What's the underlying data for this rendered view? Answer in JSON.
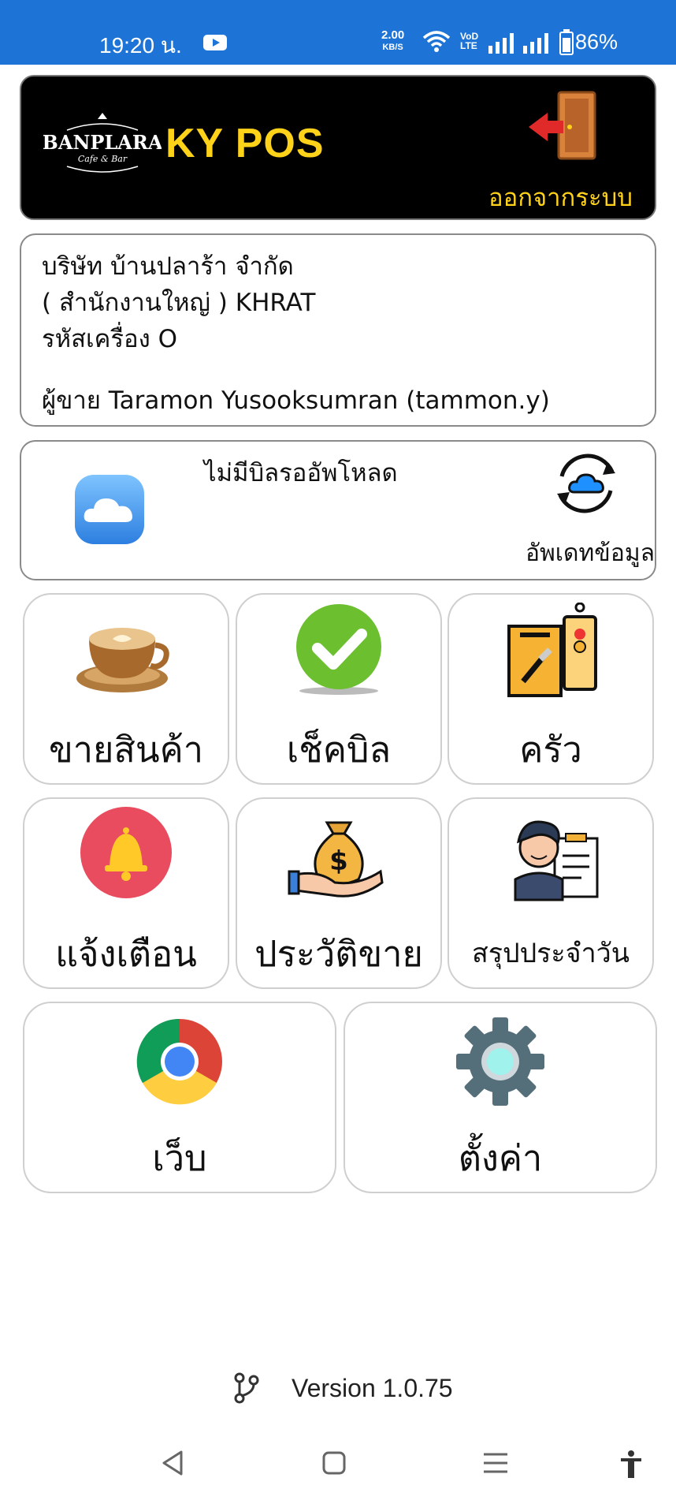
{
  "status_bar": {
    "time": "19:20 น.",
    "speed_value": "2.00",
    "speed_unit": "KB/S",
    "volte_top": "VoD",
    "volte_bottom": "LTE",
    "battery": "86%"
  },
  "header": {
    "logo_text": "BANPLARA",
    "logo_sub": "Cafe & Bar",
    "app_title": "KY POS",
    "logout_label": "ออกจากระบบ"
  },
  "info": {
    "company": "บริษัท บ้านปลาร้า จำกัด",
    "branch": "( สำนักงานใหญ่ ) KHRAT",
    "machine_code": " รหัสเครื่อง O",
    "seller": "ผู้ขาย Taramon Yusooksumran (tammon.y)"
  },
  "sync": {
    "status": "ไม่มีบิลรออัพโหลด",
    "update_label": "อัพเดทข้อมูล"
  },
  "menu": {
    "sell": "ขายสินค้า",
    "check_bill": "เช็คบิล",
    "kitchen": "ครัว",
    "notify": "แจ้งเตือน",
    "sales_history": "ประวัติขาย",
    "daily_summary": "สรุปประจำวัน",
    "web": "เว็บ",
    "settings": "ตั้งค่า"
  },
  "footer": {
    "version": "Version 1.0.75"
  },
  "colors": {
    "status_bar": "#1e74d6",
    "accent_yellow": "#ffd21a",
    "header_bg": "#000000"
  }
}
